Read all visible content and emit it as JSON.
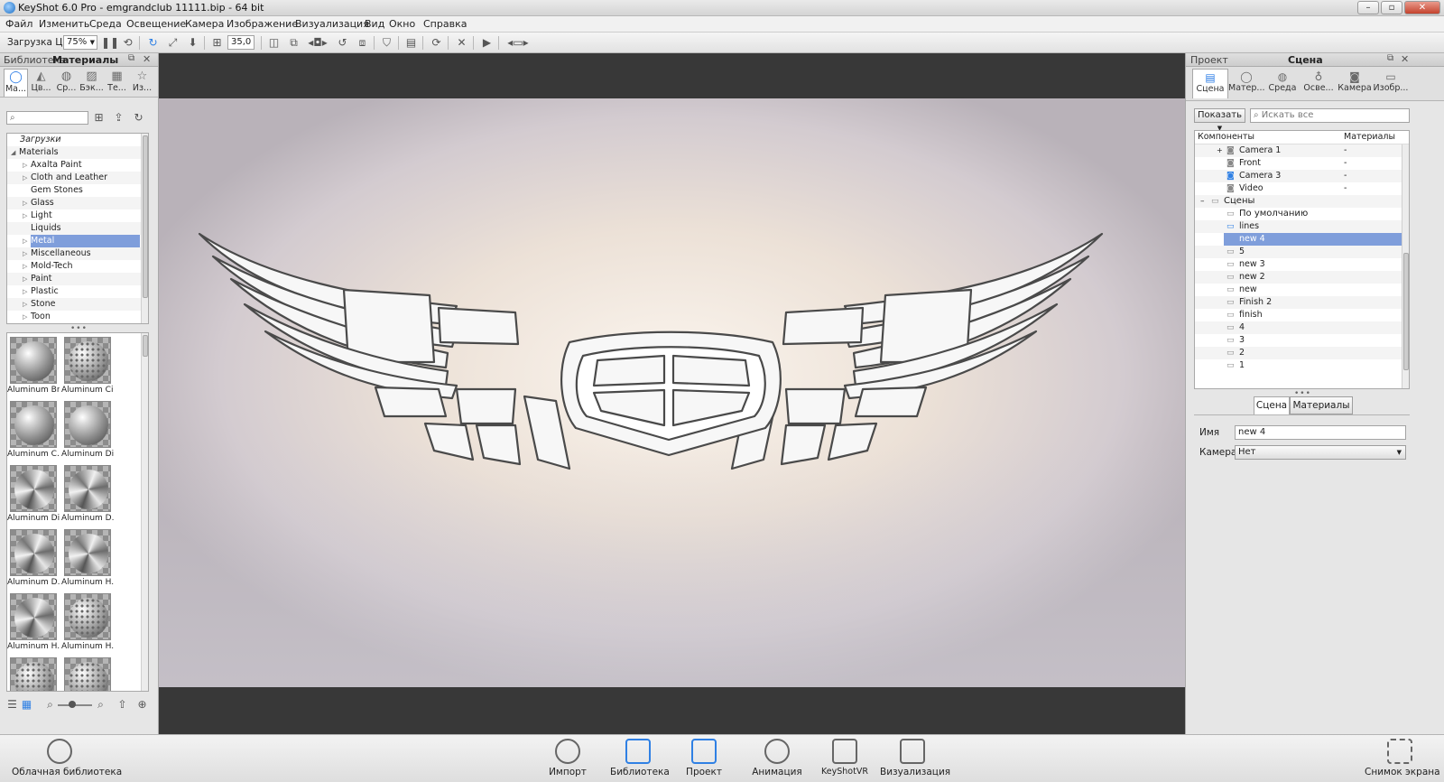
{
  "window": {
    "title": "KeyShot 6.0 Pro  - emgrandclub 11111.bip - 64 bit"
  },
  "menu": [
    "Файл",
    "Изменить",
    "Среда",
    "Освещение",
    "Камера",
    "Изображение",
    "Визуализация",
    "Вид",
    "Окно",
    "Справка"
  ],
  "toolbar": {
    "cpu_label": "Загрузка ЦП",
    "cpu_value": "75%",
    "fov_value": "35,0"
  },
  "left_panel": {
    "title_library": "Библиотека",
    "title_active": "Материалы",
    "tabs": [
      "Ма...",
      "Цв...",
      "Ср...",
      "Бэк...",
      "Те...",
      "Из..."
    ],
    "tree": {
      "root_downloads": "Загрузки",
      "root_materials": "Materials",
      "items": [
        "Axalta Paint",
        "Cloth and Leather",
        "Gem Stones",
        "Glass",
        "Light",
        "Liquids",
        "Metal",
        "Miscellaneous",
        "Mold-Tech",
        "Paint",
        "Plastic",
        "Stone",
        "Toon"
      ],
      "selected": "Metal"
    },
    "thumbnails": [
      "Aluminum Br...",
      "Aluminum Ci...",
      "Aluminum C...",
      "Aluminum Di...",
      "Aluminum Di...",
      "Aluminum D...",
      "Aluminum D...",
      "Aluminum H...",
      "Aluminum H...",
      "Aluminum H..."
    ]
  },
  "right_panel": {
    "title_project": "Проект",
    "title_active": "Сцена",
    "tabs": [
      "Сцена",
      "Матер...",
      "Среда",
      "Осве...",
      "Камера",
      "Изобр..."
    ],
    "show_button": "Показать",
    "search_placeholder": "Искать все",
    "columns": {
      "components": "Компоненты",
      "materials": "Материалы"
    },
    "cameras": [
      {
        "name": "Camera 1",
        "mat": "-"
      },
      {
        "name": "Front",
        "mat": "-"
      },
      {
        "name": "Camera 3",
        "mat": "-"
      },
      {
        "name": "Video",
        "mat": "-"
      }
    ],
    "scenes_label": "Сцены",
    "scenes": [
      "По умолчанию",
      "lines",
      "new 4",
      "5",
      "new 3",
      "new 2",
      "new",
      "Finish 2",
      "finish",
      "4",
      "3",
      "2",
      "1"
    ],
    "selected_scene": "new 4",
    "subtabs": [
      "Сцена",
      "Материалы"
    ],
    "props": {
      "name_label": "Имя",
      "name_value": "new 4",
      "camera_label": "Камера",
      "camera_value": "Нет"
    }
  },
  "bottom_bar": {
    "cloud_library": "Облачная библиотека",
    "items": [
      "Импорт",
      "Библиотека",
      "Проект",
      "Анимация",
      "KeyShotVR",
      "Визуализация"
    ],
    "screenshot": "Снимок экрана"
  },
  "colors": {
    "accent": "#2f80e4",
    "selection": "#7f9edb",
    "viewport_bg": "#383838"
  }
}
